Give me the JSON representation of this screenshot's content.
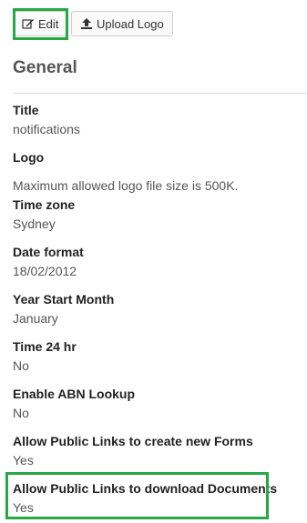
{
  "toolbar": {
    "edit_label": "Edit",
    "upload_label": "Upload Logo",
    "edit_icon": "edit-icon",
    "upload_icon": "upload-icon"
  },
  "section": {
    "title": "General"
  },
  "fields": [
    {
      "label": "Title",
      "value": "notifications"
    },
    {
      "label": "Logo",
      "value": "Maximum allowed logo file size is 500K."
    },
    {
      "label": "Time zone",
      "value": "Sydney"
    },
    {
      "label": "Date format",
      "value": "18/02/2012"
    },
    {
      "label": "Year Start Month",
      "value": "January"
    },
    {
      "label": "Time 24 hr",
      "value": "No"
    },
    {
      "label": "Enable ABN Lookup",
      "value": "No"
    },
    {
      "label": "Allow Public Links to create new Forms",
      "value": "Yes"
    },
    {
      "label": "Allow Public Links to download Documents",
      "value": "Yes"
    }
  ],
  "colors": {
    "highlight": "#28a745"
  }
}
